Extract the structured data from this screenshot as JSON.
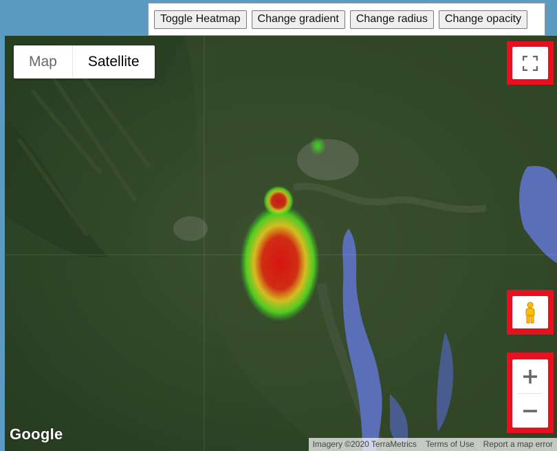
{
  "controls": {
    "toggle_heatmap": "Toggle Heatmap",
    "change_gradient": "Change gradient",
    "change_radius": "Change radius",
    "change_opacity": "Change opacity"
  },
  "map_type": {
    "options": [
      "Map",
      "Satellite"
    ],
    "selected": "Satellite"
  },
  "map_controls": {
    "fullscreen_icon": "fullscreen-icon",
    "pegman_icon": "pegman-icon",
    "zoom_in_label": "+",
    "zoom_out_label": "−",
    "highlight_color": "#e8101e"
  },
  "branding": {
    "logo": "Google"
  },
  "attribution": {
    "imagery": "Imagery ©2020 TerraMetrics",
    "terms": "Terms of Use",
    "report": "Report a map error"
  },
  "heatmap": {
    "gradient_colors": [
      "#00ff00",
      "#aaff00",
      "#ffff00",
      "#ff6600",
      "#ff0000"
    ],
    "visible": true
  }
}
